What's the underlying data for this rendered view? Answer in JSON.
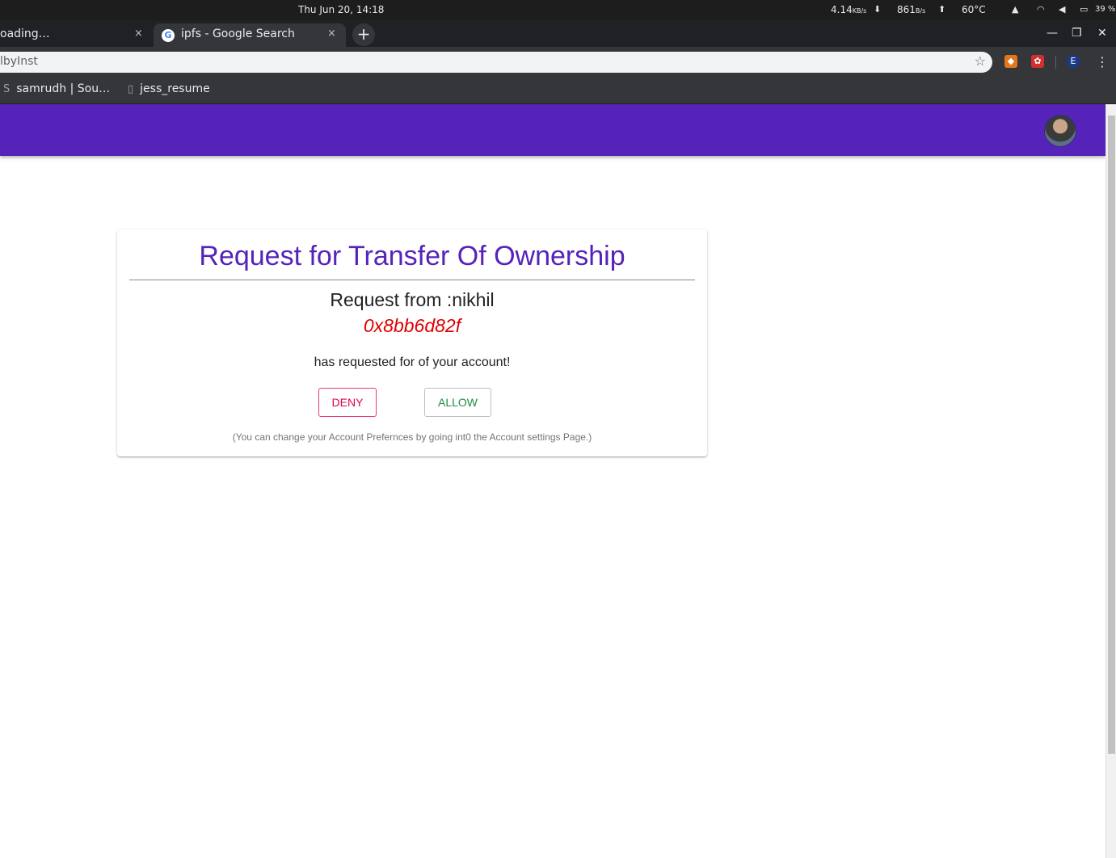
{
  "system_bar": {
    "clock": "Thu Jun 20, 14:18",
    "down_speed": "4.14",
    "down_unit": "KB/s",
    "up_speed": "861",
    "up_unit": "B/s",
    "temperature": "60°C",
    "battery": "39 %"
  },
  "tabs": [
    {
      "label": "oading…",
      "close": "×"
    },
    {
      "label": "ipfs - Google Search",
      "close": "×",
      "icon": "google-icon"
    }
  ],
  "new_tab": "+",
  "omnibox": {
    "url": "lbyInst",
    "star": "☆"
  },
  "extensions": {
    "profile_initial": "E"
  },
  "bookmarks": [
    {
      "label": "samrudh | Sou…"
    },
    {
      "label": "jess_resume"
    }
  ],
  "card": {
    "title": "Request for Transfer Of Ownership",
    "request_from": "Request from :nikhil",
    "address": "0x8bb6d82f",
    "message": "has requested for of your account!",
    "deny_label": "DENY",
    "allow_label": "ALLOW",
    "note": "(You can change your Account Prefernces by going int0 the Account settings Page.)"
  },
  "colors": {
    "appbar": "#5523b9",
    "title": "#5523b9",
    "address": "#e00000",
    "deny": "#e0004a",
    "allow": "#1e8e3e"
  }
}
